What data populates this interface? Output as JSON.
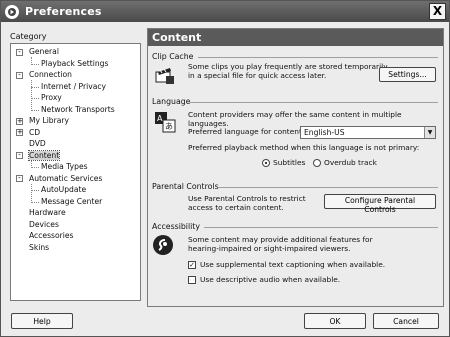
{
  "window": {
    "title": "Preferences",
    "close_label": "X"
  },
  "category": {
    "label": "Category",
    "items": [
      {
        "label": "General",
        "level": 0,
        "expander": "-"
      },
      {
        "label": "Playback Settings",
        "level": 1
      },
      {
        "label": "Connection",
        "level": 0,
        "expander": "-"
      },
      {
        "label": "Internet / Privacy",
        "level": 1
      },
      {
        "label": "Proxy",
        "level": 1
      },
      {
        "label": "Network Transports",
        "level": 1
      },
      {
        "label": "My Library",
        "level": 0,
        "expander": "+"
      },
      {
        "label": "CD",
        "level": 0,
        "expander": "+"
      },
      {
        "label": "DVD",
        "level": 0
      },
      {
        "label": "Content",
        "level": 0,
        "expander": "-",
        "selected": true
      },
      {
        "label": "Media Types",
        "level": 1
      },
      {
        "label": "Automatic Services",
        "level": 0,
        "expander": "-"
      },
      {
        "label": "AutoUpdate",
        "level": 1
      },
      {
        "label": "Message Center",
        "level": 1
      },
      {
        "label": "Hardware",
        "level": 0
      },
      {
        "label": "Devices",
        "level": 0
      },
      {
        "label": "Accessories",
        "level": 0
      },
      {
        "label": "Skins",
        "level": 0
      }
    ]
  },
  "panel": {
    "title": "Content",
    "clip_cache": {
      "title": "Clip Cache",
      "desc_line1": "Some clips you play frequently are stored temporarily",
      "desc_line2": "in a special file for quick access later.",
      "button": "Settings..."
    },
    "language": {
      "title": "Language",
      "desc": "Content providers may offer the same content in multiple languages.",
      "preferred_label": "Preferred language for content:",
      "preferred_value": "English-US",
      "playback_label": "Preferred playback method when this language is not primary:",
      "option_subtitles": "Subtitles",
      "option_overdub": "Overdub track",
      "selected_option": "Subtitles"
    },
    "parental": {
      "title": "Parental Controls",
      "desc_line1": "Use Parental Controls to restrict",
      "desc_line2": "access to certain content.",
      "button": "Configure Parental Controls"
    },
    "accessibility": {
      "title": "Accessibility",
      "desc_line1": "Some content may provide additional features for",
      "desc_line2": "hearing-impaired or sight-impaired viewers.",
      "check1_label": "Use supplemental text captioning when available.",
      "check1_checked": true,
      "check2_label": "Use descriptive audio when available.",
      "check2_checked": false
    }
  },
  "footer": {
    "help": "Help",
    "ok": "OK",
    "cancel": "Cancel"
  }
}
